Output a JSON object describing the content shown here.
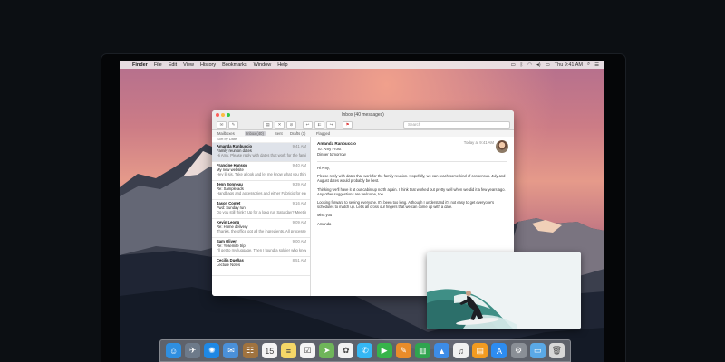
{
  "menubar": {
    "items": [
      "Finder",
      "File",
      "Edit",
      "View",
      "History",
      "Bookmarks",
      "Window",
      "Help"
    ],
    "clock": "Thu 9:41 AM"
  },
  "mail": {
    "window_title": "Inbox (40 messages)",
    "search_placeholder": "Search",
    "favorites": [
      "Mailboxes",
      "Inbox (40)",
      "Sent",
      "Drafts (1)",
      "Flagged"
    ],
    "sort_label": "Sort by Date",
    "messages": [
      {
        "from": "Amanda Ranbuccio",
        "time": "9:41 AM",
        "subject": "Family reunion dates",
        "preview": "Hi Amy, Please reply with dates that work for the family reunion."
      },
      {
        "from": "Francine Hanson",
        "time": "9:40 AM",
        "subject": "My new website",
        "preview": "Hey lil sis. Take a look and let me know what you think. I'm not feeling so stressed."
      },
      {
        "from": "Jenn Bonneau",
        "time": "9:39 AM",
        "subject": "Re: Sample ads",
        "preview": "Handbags and accessories and either Fabricio for each."
      },
      {
        "from": "Jason Comet",
        "time": "9:16 AM",
        "subject": "Fwd: Sunday run",
        "preview": "Do you still think? Up for a long run Saturday? Meet in the park."
      },
      {
        "from": "Kevin Leong",
        "time": "9:09 AM",
        "subject": "Re: Home delivery",
        "preview": "Thanks, the office got all the ingredients. All processed. We have plenty."
      },
      {
        "from": "Sam Oliver",
        "time": "9:00 AM",
        "subject": "Re: Yosemite trip",
        "preview": "I'll get to my luggage. Then I found a soldier who knew on Yosemite Valley."
      },
      {
        "from": "Cecilia Dueñas",
        "time": "8:51 AM",
        "subject": "Lecture Notes",
        "preview": ""
      }
    ],
    "reader": {
      "from": "Amanda Ranbuccio",
      "date": "Today at 9:41 AM",
      "to": "To: Amy Frost",
      "subject": "Dinner tomorrow",
      "greeting": "Hi Amy,",
      "body": [
        "Please reply with dates that work for the family reunion. Hopefully, we can reach some kind of consensus. July and August dates would probably be best.",
        "Thinking we'll have it at our cabin up north again. I think that worked out pretty well when we did it a few years ago. Any other suggestions are welcome, too.",
        "Looking forward to seeing everyone. It's been too long. Although I understand it's not easy to get everyone's schedules to match up. Let's all cross our fingers that we can come up with a date."
      ],
      "signoff": "Miss you",
      "signature": "Amanda"
    }
  },
  "dock": {
    "icons": [
      {
        "name": "finder-icon",
        "glyph": "☺",
        "color": "#2f8fe0"
      },
      {
        "name": "launchpad-icon",
        "glyph": "✈",
        "color": "#6d7a8a"
      },
      {
        "name": "safari-icon",
        "glyph": "✺",
        "color": "#1e88e5"
      },
      {
        "name": "mail-icon",
        "glyph": "✉",
        "color": "#4a90d9"
      },
      {
        "name": "contacts-icon",
        "glyph": "☷",
        "color": "#a0733f"
      },
      {
        "name": "calendar-icon",
        "glyph": "15",
        "color": "#f4f4f4"
      },
      {
        "name": "notes-icon",
        "glyph": "≡",
        "color": "#f5d767"
      },
      {
        "name": "reminders-icon",
        "glyph": "☑",
        "color": "#f4f4f4"
      },
      {
        "name": "maps-icon",
        "glyph": "➤",
        "color": "#6fb55a"
      },
      {
        "name": "photos-icon",
        "glyph": "✿",
        "color": "#f2f2f2"
      },
      {
        "name": "messages-icon",
        "glyph": "✆",
        "color": "#35b7f3"
      },
      {
        "name": "facetime-icon",
        "glyph": "▶",
        "color": "#37b34a"
      },
      {
        "name": "pages-icon",
        "glyph": "✎",
        "color": "#e98c2a"
      },
      {
        "name": "numbers-icon",
        "glyph": "▥",
        "color": "#2fa44f"
      },
      {
        "name": "keynote-icon",
        "glyph": "▲",
        "color": "#3c8ce7"
      },
      {
        "name": "itunes-icon",
        "glyph": "♫",
        "color": "#f1f1f1"
      },
      {
        "name": "ibooks-icon",
        "glyph": "▤",
        "color": "#f39b20"
      },
      {
        "name": "app-store-icon",
        "glyph": "A",
        "color": "#2d8cf0"
      },
      {
        "name": "system-preferences-icon",
        "glyph": "⚙",
        "color": "#8a8f96"
      },
      {
        "name": "downloads-folder-icon",
        "glyph": "▭",
        "color": "#5aa9e6"
      },
      {
        "name": "trash-icon",
        "glyph": "🗑",
        "color": "#d8d8d8"
      }
    ]
  }
}
